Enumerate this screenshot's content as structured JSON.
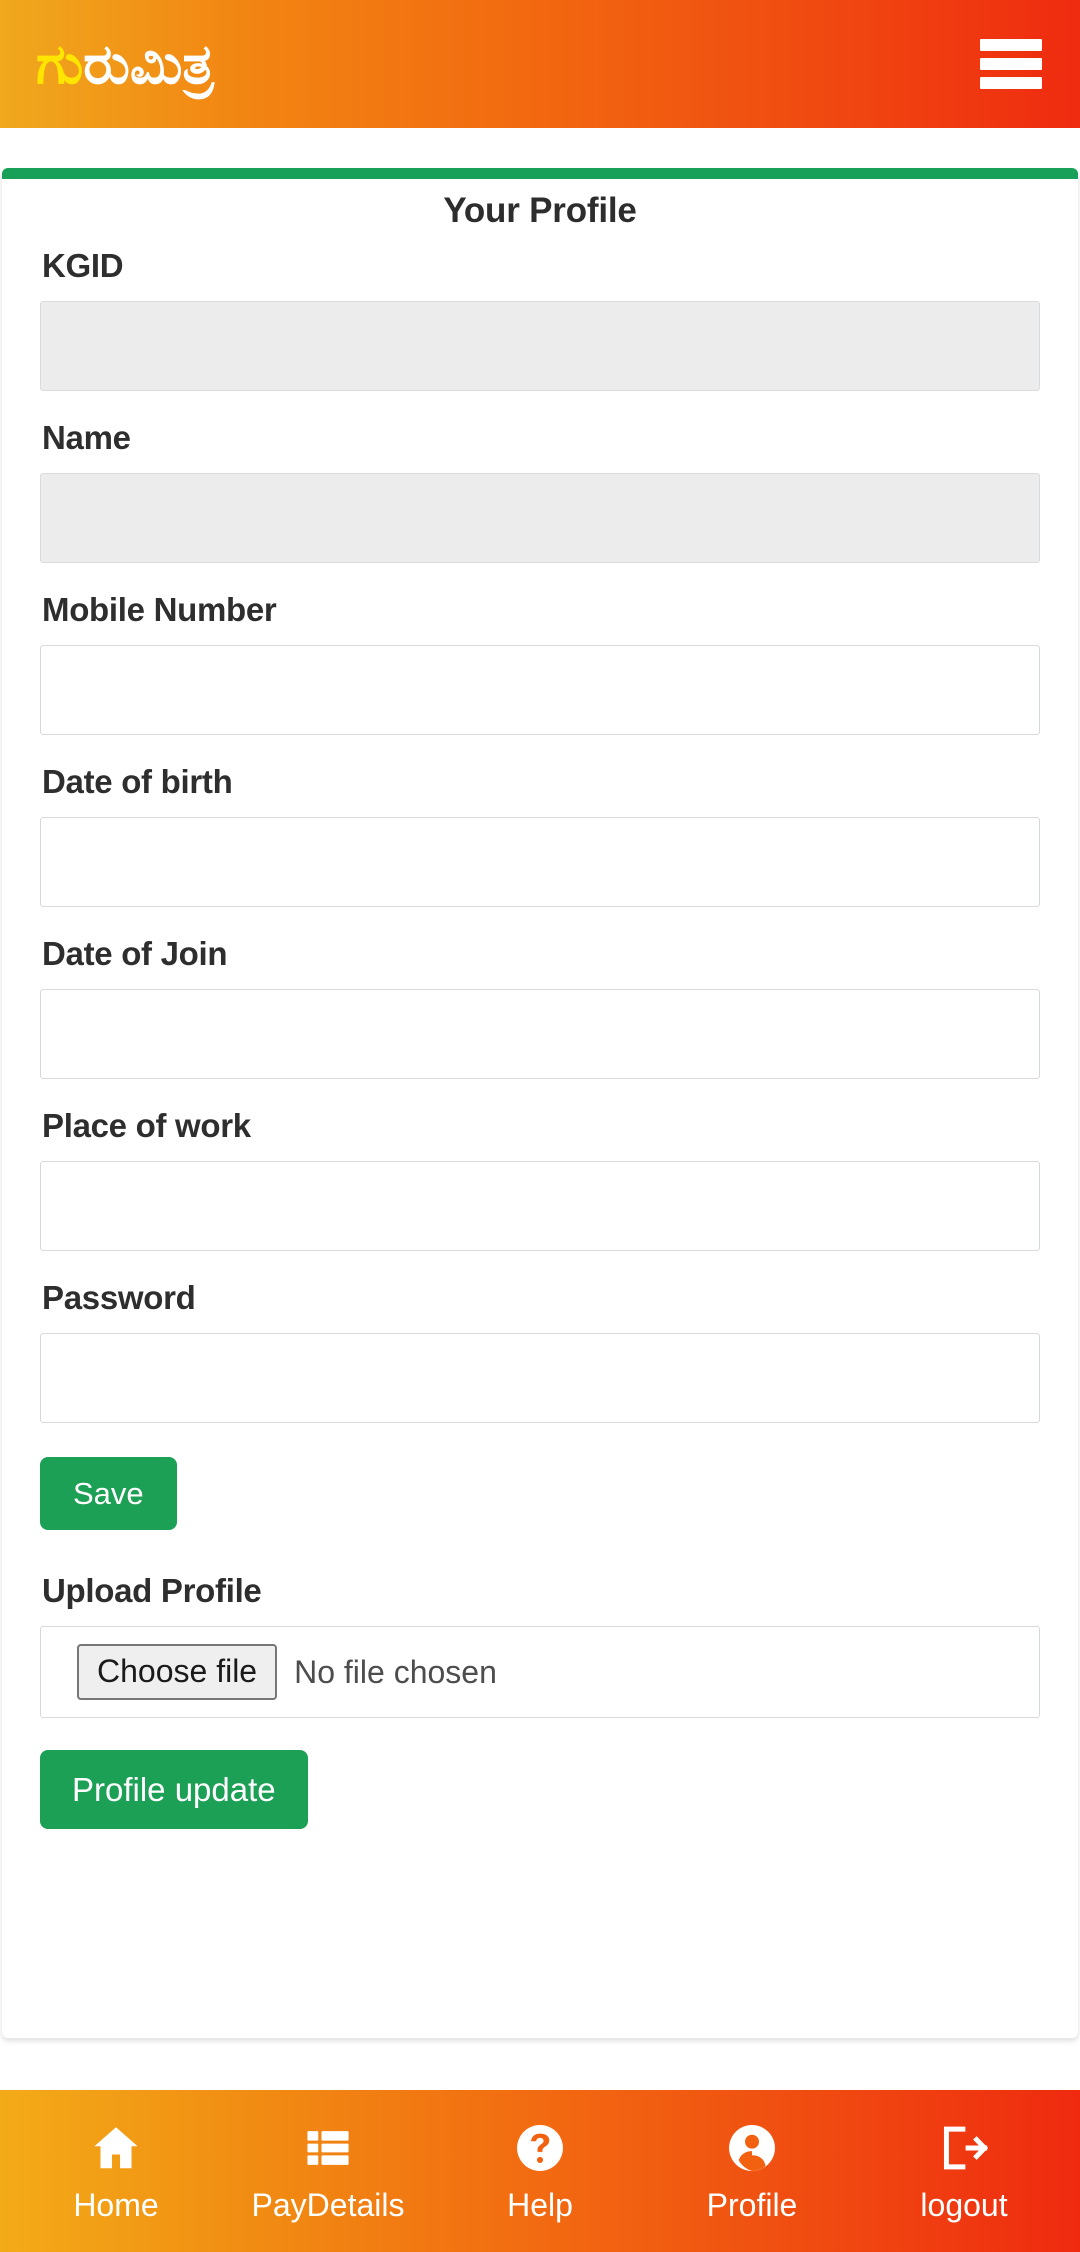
{
  "header": {
    "brand_part1": "ಗು",
    "brand_part2": "ರುಮಿತ್ರ",
    "menu_icon": "hamburger-icon",
    "gradient_start": "#f0a81d",
    "gradient_end": "#ef2b10"
  },
  "card": {
    "title": "Your Profile",
    "accent_color": "#18a058"
  },
  "form": {
    "fields": [
      {
        "label": "KGID",
        "value": "",
        "placeholder": "",
        "disabled": true
      },
      {
        "label": "Name",
        "value": "",
        "placeholder": "",
        "disabled": true
      },
      {
        "label": "Mobile Number",
        "value": "",
        "placeholder": "",
        "disabled": false
      },
      {
        "label": "Date of birth",
        "value": "",
        "placeholder": "",
        "disabled": false
      },
      {
        "label": "Date of Join",
        "value": "",
        "placeholder": "",
        "disabled": false
      },
      {
        "label": "Place of work",
        "value": "",
        "placeholder": "",
        "disabled": false
      },
      {
        "label": "Password",
        "value": "",
        "placeholder": "",
        "disabled": false
      }
    ],
    "save_label": "Save",
    "upload_label": "Upload Profile",
    "file_button_label": "Choose file",
    "file_status": "No file chosen",
    "update_label": "Profile update",
    "button_color": "#1ba055"
  },
  "bottom_nav": [
    {
      "label": "Home",
      "icon": "home-icon"
    },
    {
      "label": "PayDetails",
      "icon": "list-icon"
    },
    {
      "label": "Help",
      "icon": "question-circle-icon"
    },
    {
      "label": "Profile",
      "icon": "user-circle-icon"
    },
    {
      "label": "logout",
      "icon": "logout-icon"
    }
  ]
}
